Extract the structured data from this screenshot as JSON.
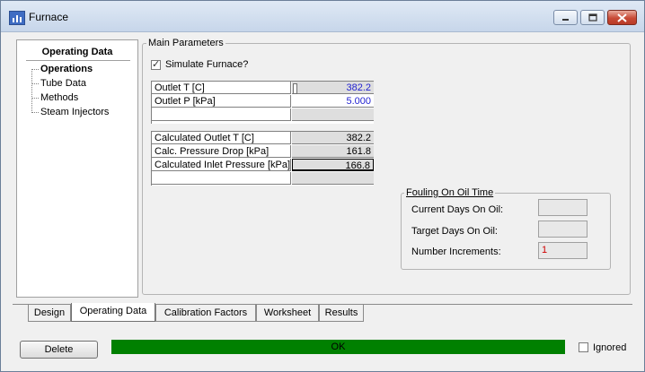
{
  "window": {
    "title": "Furnace",
    "accent": "#3e6cc3",
    "minimize_icon": "minimize-icon",
    "maximize_icon": "maximize-icon",
    "close_icon": "close-icon"
  },
  "nav": {
    "title": "Operating Data",
    "items": [
      {
        "label": "Operations",
        "selected": true
      },
      {
        "label": "Tube Data",
        "selected": false
      },
      {
        "label": "Methods",
        "selected": false
      },
      {
        "label": "Steam Injectors",
        "selected": false
      }
    ]
  },
  "main_parameters": {
    "group_label": "Main Parameters",
    "simulate_label": "Simulate Furnace?",
    "simulate_checked": true,
    "inputs": [
      {
        "label": "Outlet T [C]",
        "value": "382.2"
      },
      {
        "label": "Outlet P [kPa]",
        "value": "5.000"
      },
      {
        "label": "",
        "value": ""
      }
    ],
    "calculated": [
      {
        "label": "Calculated Outlet T [C]",
        "value": "382.2"
      },
      {
        "label": "Calc. Pressure Drop [kPa]",
        "value": "161.8"
      },
      {
        "label": "Calculated Inlet Pressure [kPa]",
        "value": "166.8"
      },
      {
        "label": "",
        "value": ""
      }
    ]
  },
  "fouling": {
    "group_label": "Fouling On Oil Time",
    "fields": [
      {
        "label": "Current Days On Oil:",
        "value": ""
      },
      {
        "label": "Target Days On Oil:",
        "value": ""
      },
      {
        "label": "Number Increments:",
        "value": "1"
      }
    ]
  },
  "tabs": [
    {
      "label": "Design",
      "active": false
    },
    {
      "label": "Operating Data",
      "active": true
    },
    {
      "label": "Calibration Factors",
      "active": false
    },
    {
      "label": "Worksheet",
      "active": false
    },
    {
      "label": "Results",
      "active": false
    }
  ],
  "footer": {
    "delete_label": "Delete",
    "status_text": "OK",
    "status_color": "#008000",
    "ignored_label": "Ignored",
    "ignored_checked": false
  }
}
